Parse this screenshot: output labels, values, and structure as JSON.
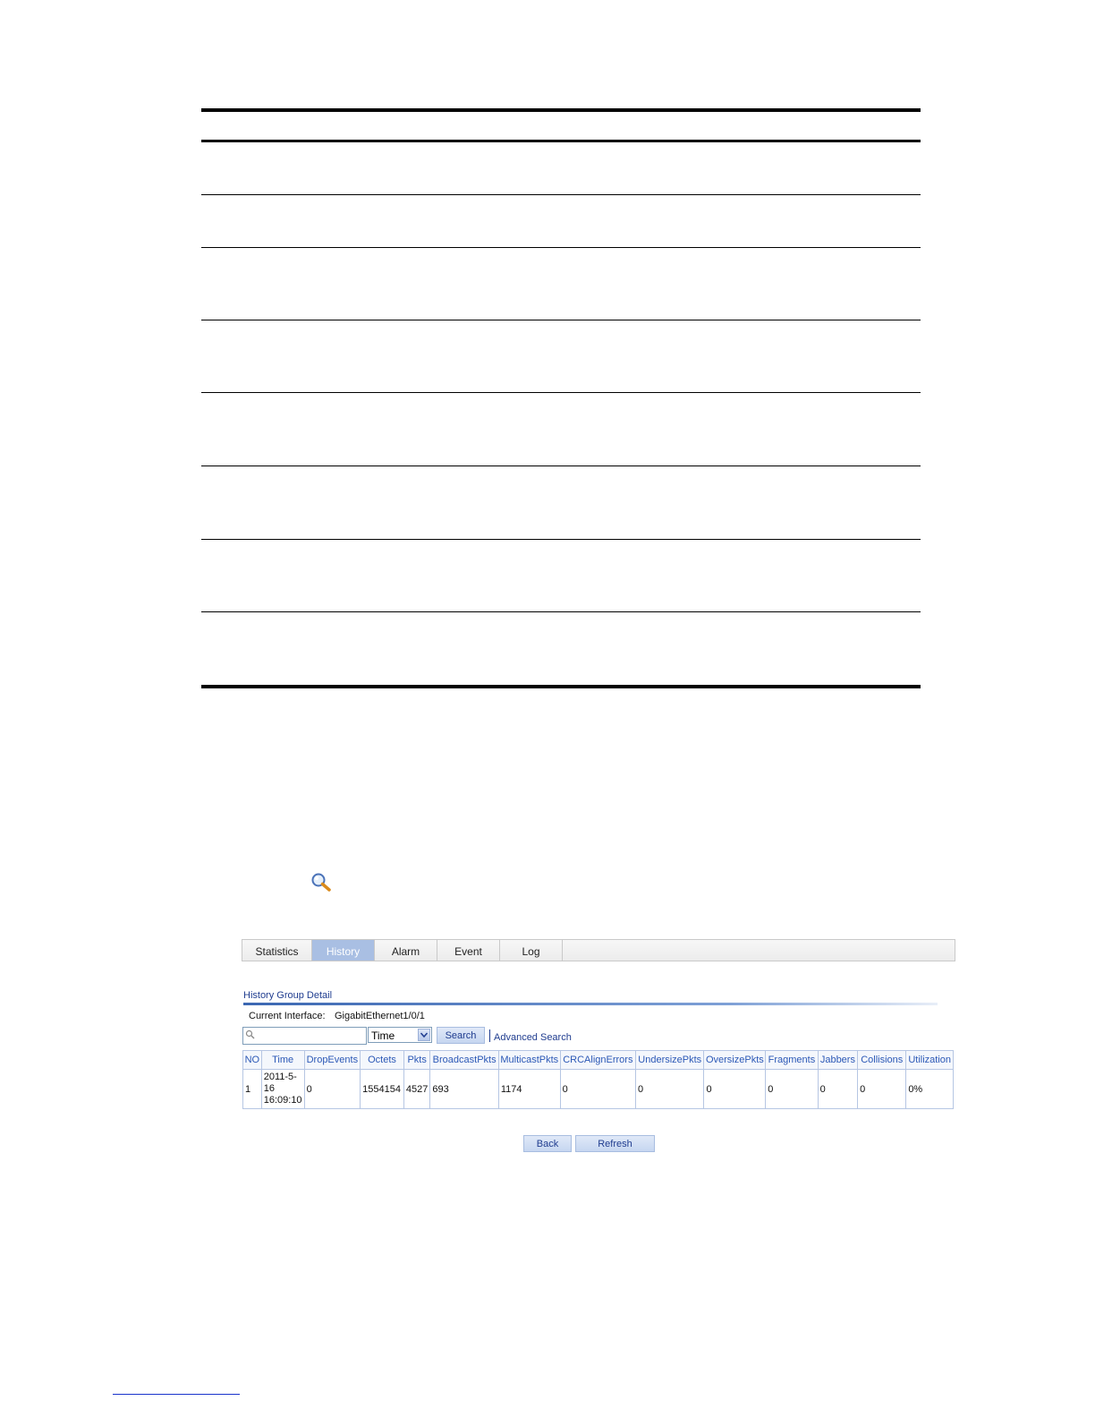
{
  "tabs": [
    "Statistics",
    "History",
    "Alarm",
    "Event",
    "Log"
  ],
  "active_tab": "History",
  "section_title": "History Group Detail",
  "current_interface": {
    "label": "Current Interface:",
    "value": "GigabitEthernet1/0/1"
  },
  "search": {
    "value": "",
    "select_value": "Time",
    "search_label": "Search",
    "advanced_label": "Advanced Search"
  },
  "table": {
    "columns": [
      "NO",
      "Time",
      "DropEvents",
      "Octets",
      "Pkts",
      "BroadcastPkts",
      "MulticastPkts",
      "CRCAlignErrors",
      "UndersizePkts",
      "OversizePkts",
      "Fragments",
      "Jabbers",
      "Collisions",
      "Utilization"
    ],
    "rows": [
      [
        "1",
        "2011-5-\n16\n16:09:10",
        "0",
        "1554154",
        "4527",
        "693",
        "1174",
        "0",
        "0",
        "0",
        "0",
        "0",
        "0",
        "0%"
      ]
    ]
  },
  "buttons": {
    "back": "Back",
    "refresh": "Refresh"
  },
  "colors": {
    "active_tab": "#a9bfe3",
    "header_text": "#2b58b6",
    "link": "#1f3c8f"
  }
}
